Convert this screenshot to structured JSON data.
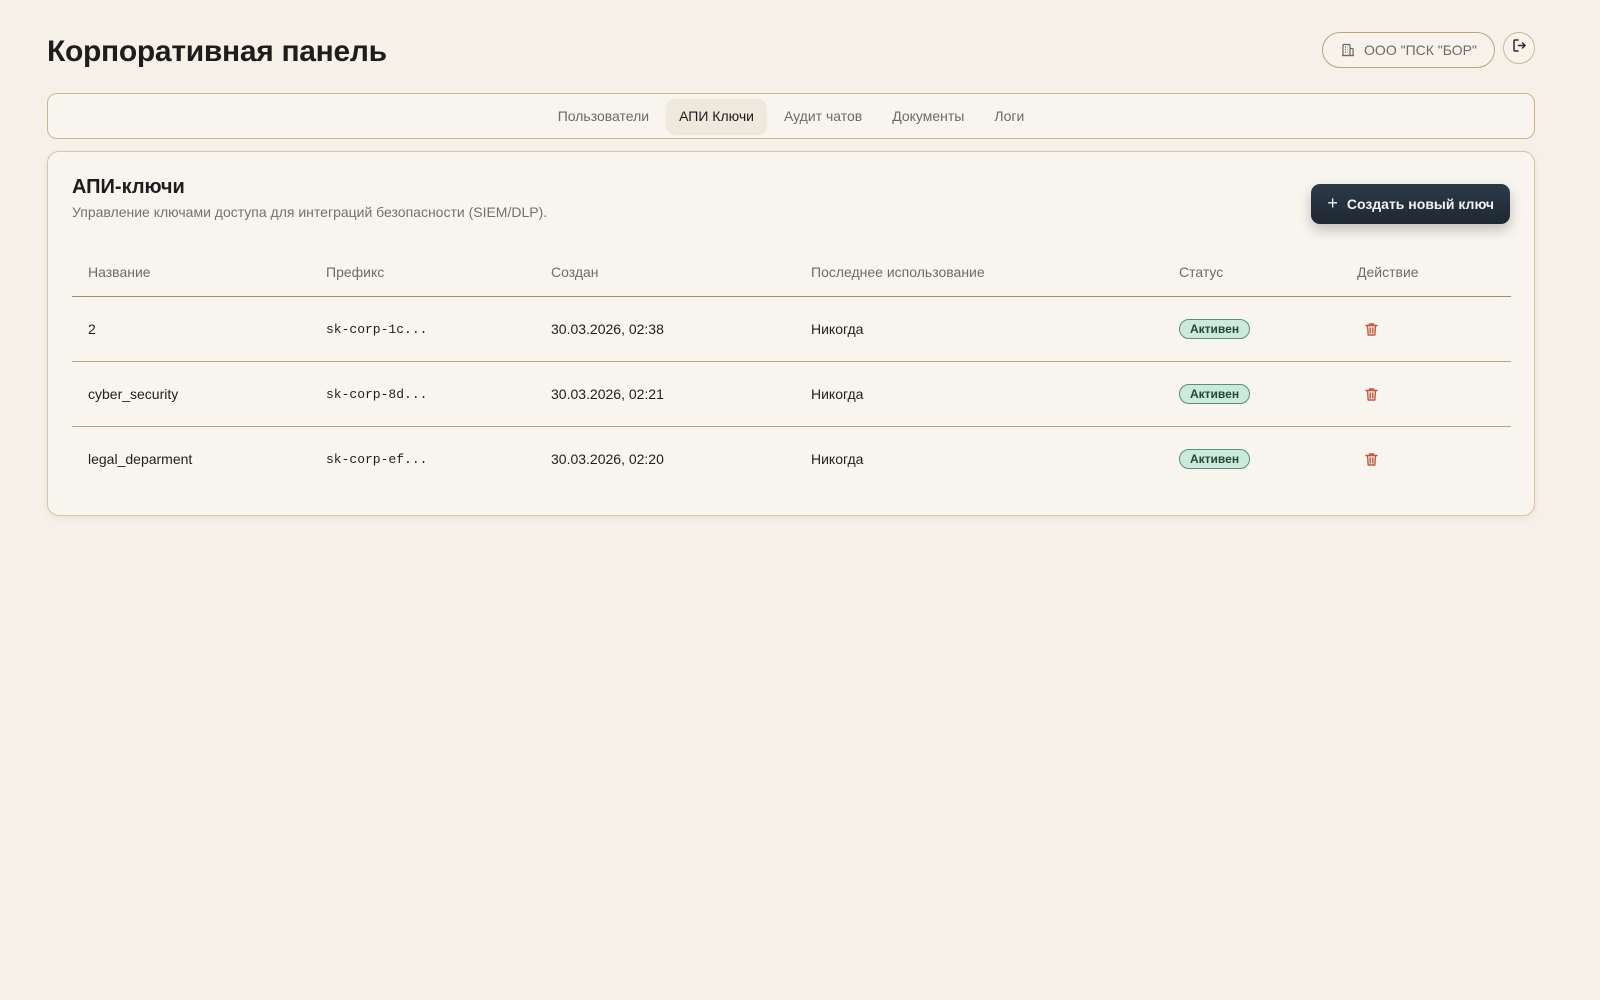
{
  "header": {
    "title": "Корпоративная панель",
    "org_name": "ООО \"ПСК \"БОР\"",
    "org_icon": "building-icon",
    "logout_icon": "logout-icon"
  },
  "tabs": [
    {
      "label": "Пользователи",
      "active": false
    },
    {
      "label": "АПИ Ключи",
      "active": true
    },
    {
      "label": "Аудит чатов",
      "active": false
    },
    {
      "label": "Документы",
      "active": false
    },
    {
      "label": "Логи",
      "active": false
    }
  ],
  "card": {
    "title": "АПИ-ключи",
    "subtitle": "Управление ключами доступа для интеграций безопасности (SIEM/DLP).",
    "create_button": "Создать новый ключ",
    "columns": [
      "Название",
      "Префикс",
      "Создан",
      "Последнее использование",
      "Статус",
      "Действие"
    ],
    "rows": [
      {
        "name": "2",
        "prefix": "sk-corp-1c...",
        "created": "30.03.2026, 02:38",
        "last_used": "Никогда",
        "status": "Активен"
      },
      {
        "name": "cyber_security",
        "prefix": "sk-corp-8d...",
        "created": "30.03.2026, 02:21",
        "last_used": "Никогда",
        "status": "Активен"
      },
      {
        "name": "legal_deparment",
        "prefix": "sk-corp-ef...",
        "created": "30.03.2026, 02:20",
        "last_used": "Никогда",
        "status": "Активен"
      }
    ]
  },
  "colors": {
    "background": "#f5f0e8",
    "border_accent": "#b9a47f",
    "primary_button": "#1e2833",
    "status_bg": "#cbe9dc",
    "delete_icon": "#c0573e"
  }
}
